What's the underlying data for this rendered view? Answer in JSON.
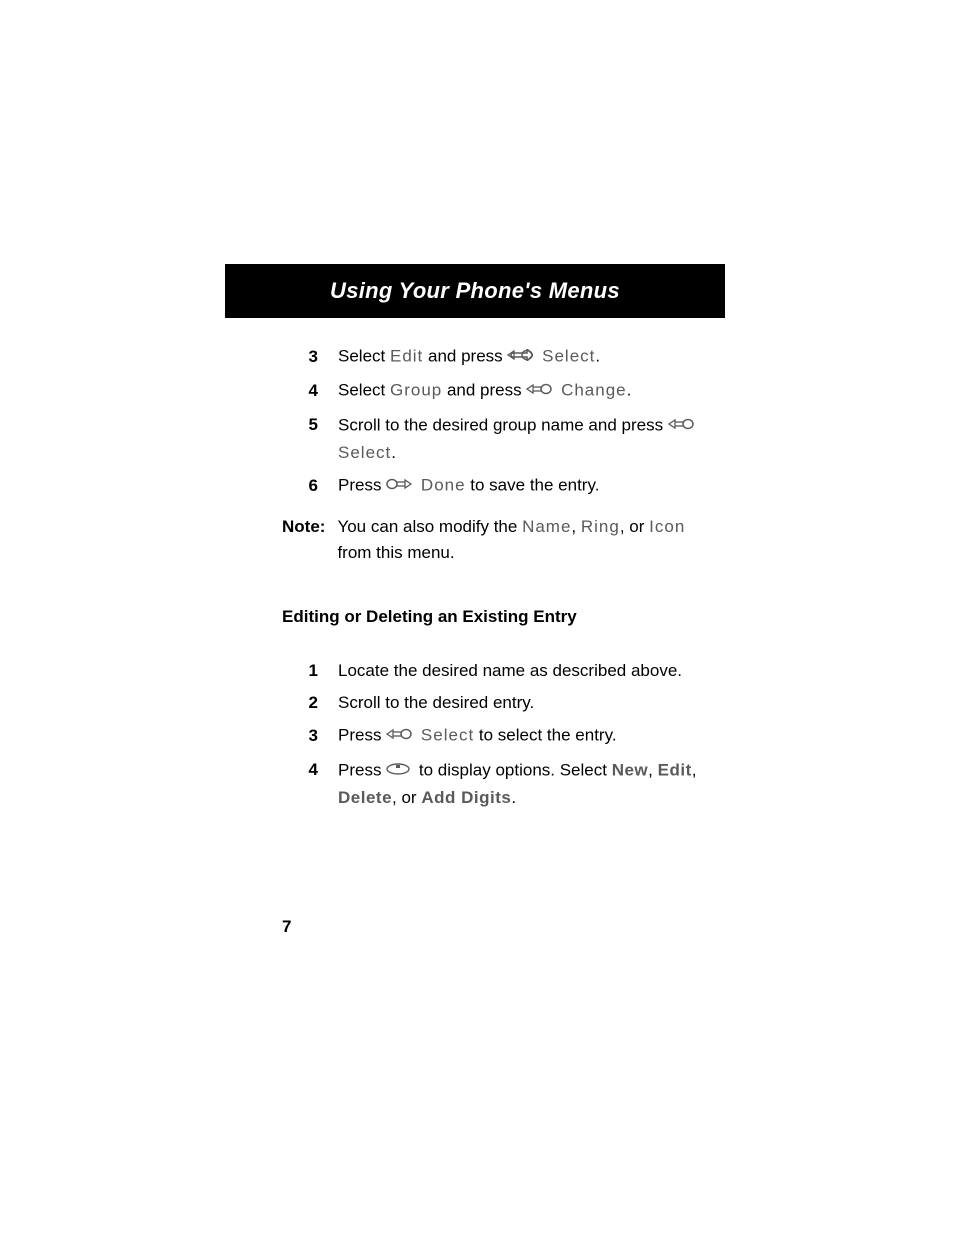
{
  "title": "Using Your Phone's Menus",
  "page_number": "7",
  "upper_steps": [
    {
      "num": "3",
      "text_prefix": "Select ",
      "phone": "Edit",
      "text_mid": " and press ",
      "btn": "Select",
      "text_suffix": "."
    },
    {
      "num": "4",
      "text_prefix": "Select ",
      "phone": "Group",
      "text_mid": " and press ",
      "btn": "Change",
      "text_suffix": "."
    },
    {
      "num": "5",
      "text_prefix": "Scroll to the desired group name and press ",
      "btn": "Select",
      "text_suffix": "."
    },
    {
      "num": "6",
      "text_prefix": "Press ",
      "btn": "Done",
      "text_suffix": " to save the entry."
    }
  ],
  "note": {
    "label": "Note:",
    "prefix": "You can also modify the ",
    "items": [
      "Name",
      "Ring",
      "Icon"
    ],
    "joins": [
      ", ",
      ", or "
    ],
    "suffix": " from this menu."
  },
  "section_heading": "Editing or Deleting an Existing Entry",
  "lower_steps": [
    {
      "num": "1",
      "text": "Locate the desired name as described above."
    },
    {
      "num": "2",
      "text": "Scroll to the desired entry."
    },
    {
      "num": "3",
      "prefix": "Press ",
      "btn": "Select",
      "suffix": " to select the entry."
    },
    {
      "num": "4",
      "line1_prefix": "Press ",
      "line1_mid": " to display options. Select ",
      "opts_a": [
        "New",
        "Edit"
      ],
      "join": ", ",
      "line2_items": [
        "Delete",
        "Add Digits"
      ],
      "line2_join": ", or ",
      "line2_suffix": "."
    }
  ]
}
